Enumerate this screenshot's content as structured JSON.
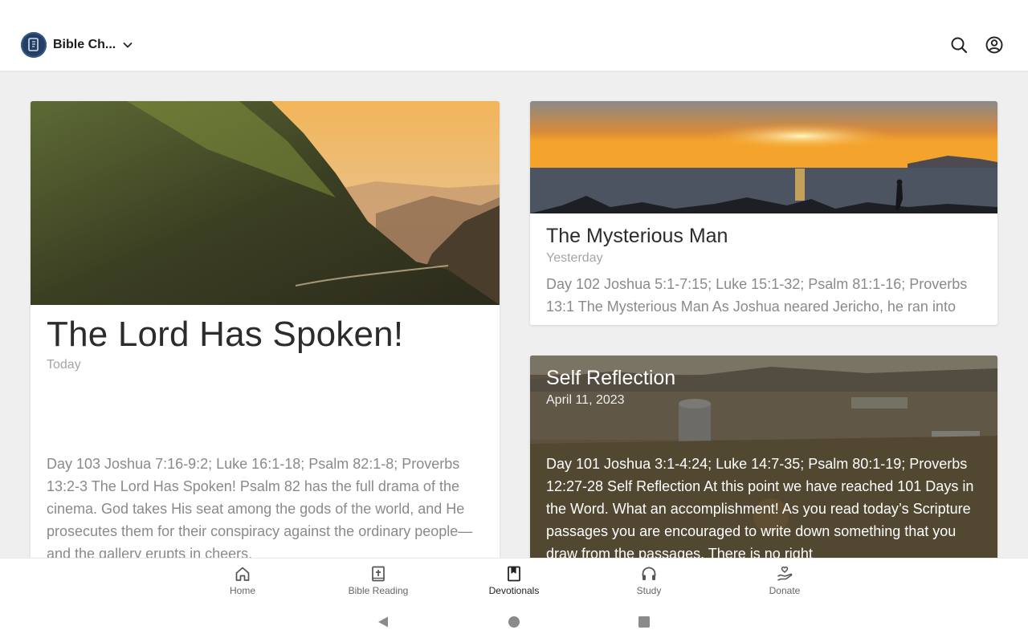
{
  "header": {
    "app_name": "Bible Ch...",
    "icons": [
      "bible-logo-icon",
      "chevron-down-icon",
      "search-icon",
      "account-icon"
    ]
  },
  "devotionals": [
    {
      "title": "The Lord Has Spoken!",
      "date": "Today",
      "excerpt": "Day 103 Joshua 7:16-9:2; Luke 16:1-18; Psalm 82:1-8; Proverbs 13:2-3 The Lord Has Spoken! Psalm 82 has the full drama of the cinema. God takes His seat among the gods of the world, and He prosecutes them for their conspiracy against the ordinary people—and the gallery erupts in cheers."
    },
    {
      "title": "The Mysterious Man",
      "date": "Yesterday",
      "excerpt": "Day 102 Joshua 5:1-7:15; Luke 15:1-32; Psalm 81:1-16; Proverbs 13:1 The Mysterious Man As Joshua neared Jericho, he ran into"
    },
    {
      "title": "Self Reflection",
      "date": "April 11, 2023",
      "excerpt": "Day 101 Joshua 3:1-4:24; Luke 14:7-35; Psalm 80:1-19; Proverbs 12:27-28 Self Reflection At this point we have reached 101 Days in the Word. What an accomplishment! As you read today’s Scripture passages you are encouraged to write down something that you draw from the passages. There is no right"
    }
  ],
  "bottom_nav": {
    "active": "Devotionals",
    "items": [
      {
        "label": "Home",
        "icon": "home-icon"
      },
      {
        "label": "Bible Reading",
        "icon": "bible-icon"
      },
      {
        "label": "Devotionals",
        "icon": "bookmark-book-icon"
      },
      {
        "label": "Study",
        "icon": "headphones-icon"
      },
      {
        "label": "Donate",
        "icon": "donate-hand-heart-icon"
      }
    ]
  },
  "system_nav": {
    "icons": [
      "back-icon",
      "home-circle-icon",
      "recents-square-icon"
    ]
  },
  "colors": {
    "accent_logo": "#243f63",
    "background": "#efefef",
    "card": "#ffffff",
    "muted_text": "#a5a5a5"
  }
}
